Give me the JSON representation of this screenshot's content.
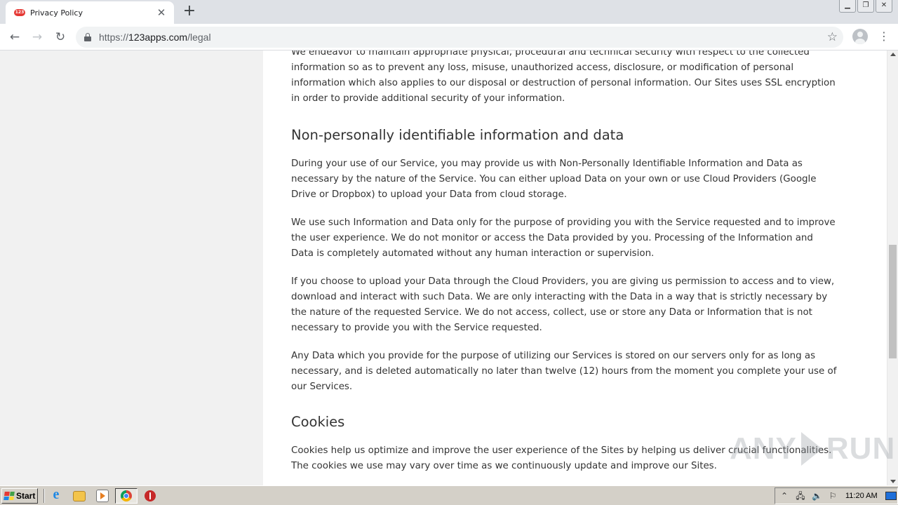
{
  "browser": {
    "tab": {
      "title": "Privacy Policy",
      "favicon_text": "123",
      "favicon_color": "#e53935"
    },
    "new_tab_icon": "plus-icon",
    "window_controls": [
      "minimize-icon",
      "restore-icon",
      "close-icon"
    ],
    "nav": {
      "back_icon": "arrow-left-icon",
      "forward_icon": "arrow-right-icon",
      "reload_icon": "reload-icon"
    },
    "address": {
      "scheme": "https://",
      "host": "123apps.com",
      "path": "/legal"
    },
    "actions": {
      "bookmark_icon": "star-icon",
      "profile_icon": "profile-icon",
      "menu_icon": "kebab-menu-icon"
    }
  },
  "page": {
    "intro_paragraph": "We endeavor to maintain appropriate physical, procedural and technical security with respect to the collected information so as to prevent any loss, misuse, unauthorized access, disclosure, or modification of personal information which also applies to our disposal or destruction of personal information. Our Sites uses SSL encryption in order to provide additional security of your information.",
    "sections": [
      {
        "heading": "Non-personally identifiable information and data",
        "paragraphs": [
          "During your use of our Service, you may provide us with Non-Personally Identifiable Information and Data as necessary by the nature of the Service. You can either upload Data on your own or use Cloud Providers (Google Drive or Dropbox) to upload your Data from cloud storage.",
          "We use such Information and Data only for the purpose of providing you with the Service requested and to improve the user experience. We do not monitor or access the Data provided by you. Processing of the Information and Data is completely automated without any human interaction or supervision.",
          "If you choose to upload your Data through the Cloud Providers, you are giving us permission to access and to view, download and interact with such Data. We are only interacting with the Data in a way that is strictly necessary by the nature of the requested Service. We do not access, collect, use or store any Data or Information that is not necessary to provide you with the Service requested.",
          "Any Data which you provide for the purpose of utilizing our Services is stored on our servers only for as long as necessary, and is deleted automatically no later than twelve (12) hours from the moment you complete your use of our Services."
        ]
      },
      {
        "heading": "Cookies",
        "paragraphs": [
          "Cookies help us optimize and improve the user experience of the Sites by helping us deliver crucial functionalities. The cookies we use may vary over time as we continuously update and improve our Sites."
        ]
      }
    ]
  },
  "watermark": {
    "left": "ANY",
    "right": "RUN"
  },
  "taskbar": {
    "start_label": "Start",
    "pinned": [
      "internet-explorer-icon",
      "folder-icon",
      "media-player-icon",
      "chrome-icon",
      "stop-icon"
    ],
    "tray": {
      "icons": [
        "chevron-up-icon",
        "network-icon",
        "volume-icon",
        "flag-icon"
      ],
      "clock": "11:20 AM"
    }
  }
}
